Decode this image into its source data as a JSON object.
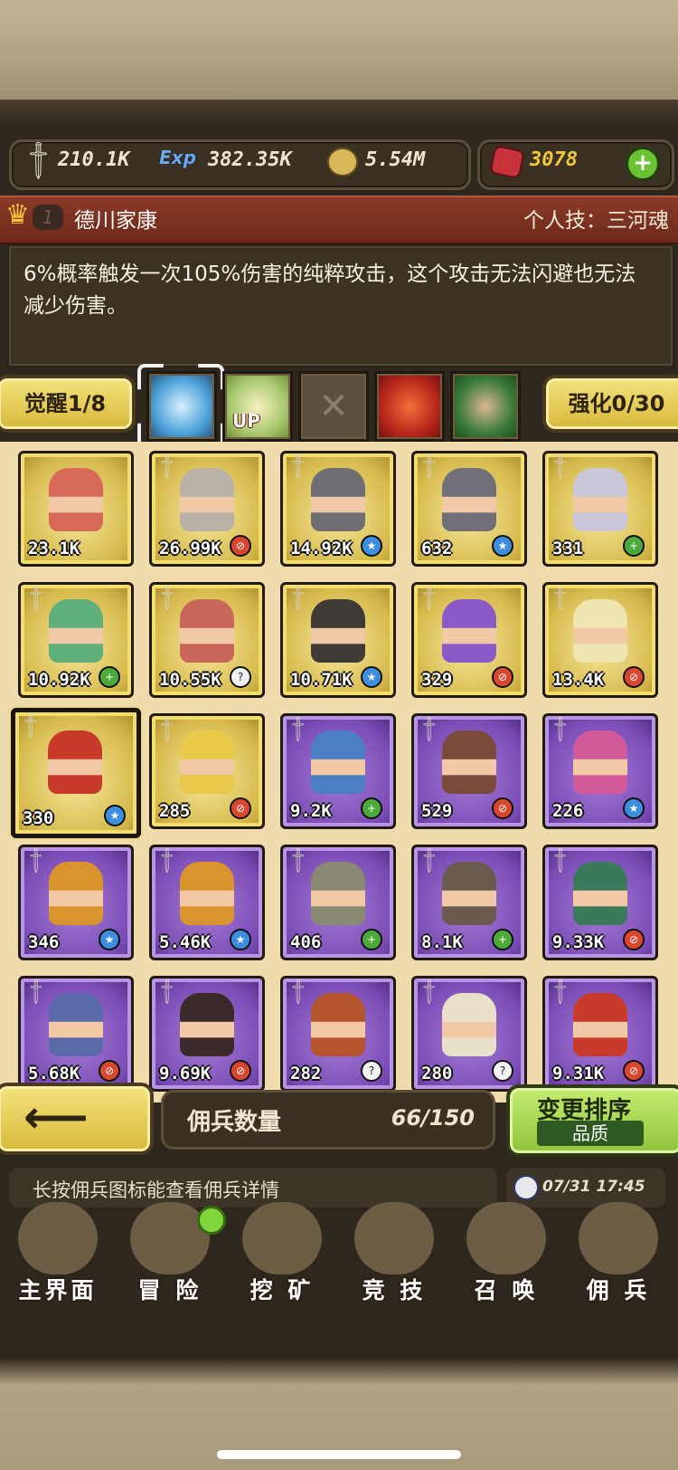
{
  "resources": {
    "attack": "210.1K",
    "exp_label": "Exp",
    "exp": "382.35K",
    "gold": "5.54M",
    "gems": "3078",
    "add_icon": "plus-icon"
  },
  "hero": {
    "rank": "1",
    "name": "德川家康",
    "skill": "个人技：三河魂",
    "description": "6%概率触发一次105%伤害的纯粹攻击，这个攻击无法闪避也无法减少伤害。"
  },
  "awaken": {
    "label": "觉醒1/8"
  },
  "enhance": {
    "label": "强化0/30"
  },
  "equip_slots": [
    {
      "icon": "lightning-orb-icon"
    },
    {
      "icon": "crown-up-icon",
      "text": "UP"
    },
    {
      "icon": "empty-slot-x-icon",
      "text": "✕"
    },
    {
      "icon": "musket-icon"
    },
    {
      "icon": "scroll-icon"
    }
  ],
  "mercenaries": [
    {
      "level": "23.1K",
      "badge": "",
      "rarity": "gold",
      "color": "#d96a5a"
    },
    {
      "level": "26.99K",
      "badge": "red",
      "rarity": "gold",
      "color": "#b8b2a8"
    },
    {
      "level": "14.92K",
      "badge": "blue",
      "rarity": "gold",
      "color": "#6e6e74"
    },
    {
      "level": "632",
      "badge": "blue",
      "rarity": "gold",
      "color": "#707078"
    },
    {
      "level": "331",
      "badge": "green",
      "rarity": "gold",
      "color": "#c8c8d8"
    },
    {
      "level": "10.92K",
      "badge": "green",
      "rarity": "gold",
      "color": "#5fb07a"
    },
    {
      "level": "10.55K",
      "badge": "white",
      "rarity": "gold",
      "color": "#c9675a"
    },
    {
      "level": "10.71K",
      "badge": "blue",
      "rarity": "gold",
      "color": "#3f3a36"
    },
    {
      "level": "329",
      "badge": "red",
      "rarity": "gold",
      "color": "#8a5ac8"
    },
    {
      "level": "13.4K",
      "badge": "red",
      "rarity": "gold",
      "color": "#f0e4b0"
    },
    {
      "level": "330",
      "badge": "blue",
      "rarity": "gold",
      "color": "#c73a2a",
      "selected": true
    },
    {
      "level": "285",
      "badge": "red",
      "rarity": "gold",
      "color": "#e8c94a"
    },
    {
      "level": "9.2K",
      "badge": "green",
      "rarity": "purple",
      "color": "#4a7fc4"
    },
    {
      "level": "529",
      "badge": "red",
      "rarity": "purple",
      "color": "#7a4a3a"
    },
    {
      "level": "226",
      "badge": "blue",
      "rarity": "purple",
      "color": "#d25a9a"
    },
    {
      "level": "346",
      "badge": "blue",
      "rarity": "purple",
      "color": "#d9942e"
    },
    {
      "level": "5.46K",
      "badge": "blue",
      "rarity": "purple",
      "color": "#d9942e"
    },
    {
      "level": "406",
      "badge": "green",
      "rarity": "purple",
      "color": "#8a8a72"
    },
    {
      "level": "8.1K",
      "badge": "green",
      "rarity": "purple",
      "color": "#6a5a50"
    },
    {
      "level": "9.33K",
      "badge": "red",
      "rarity": "purple",
      "color": "#3a7a5a"
    },
    {
      "level": "5.68K",
      "badge": "red",
      "rarity": "purple",
      "color": "#5a6aa8"
    },
    {
      "level": "9.69K",
      "badge": "red",
      "rarity": "purple",
      "color": "#3a2a2a"
    },
    {
      "level": "282",
      "badge": "white",
      "rarity": "purple",
      "color": "#b5552e"
    },
    {
      "level": "280",
      "badge": "white",
      "rarity": "purple",
      "color": "#e8e0c8"
    },
    {
      "level": "9.31K",
      "badge": "red",
      "rarity": "purple",
      "color": "#c83a2a"
    }
  ],
  "bottom": {
    "count_label": "佣兵数量",
    "count_value": "66/150",
    "sort_label": "变更排序",
    "sort_sub": "品质",
    "tip": "长按佣兵图标能查看佣兵详情",
    "time": "07/31 17:45"
  },
  "nav": [
    {
      "label": "主界面",
      "icon": "map-scroll-icon"
    },
    {
      "label": "冒 险",
      "icon": "island-icon"
    },
    {
      "label": "挖 矿",
      "icon": "pickaxe-icon"
    },
    {
      "label": "竞 技",
      "icon": "crossed-swords-icon"
    },
    {
      "label": "召 唤",
      "icon": "summon-scroll-icon"
    },
    {
      "label": "佣 兵",
      "icon": "tent-icon"
    }
  ]
}
